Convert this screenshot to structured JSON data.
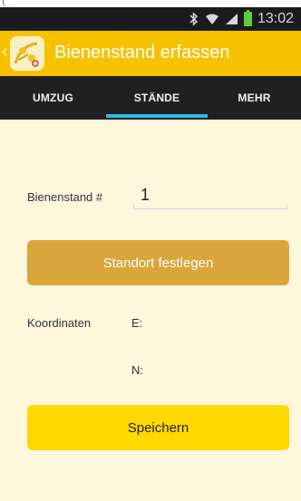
{
  "status_bar": {
    "time": "13:02",
    "icons": [
      "bluetooth-icon",
      "wifi-icon",
      "signal-icon",
      "battery-icon"
    ],
    "battery_color": "#63c93a"
  },
  "frame_glyph": "(",
  "action_bar": {
    "back_glyph": "‹",
    "title": "Bienenstand erfassen",
    "background": "#f6c200"
  },
  "tabs": [
    {
      "label": "UMZUG",
      "active": false
    },
    {
      "label": "STÄNDE",
      "active": true
    },
    {
      "label": "MEHR",
      "active": false
    }
  ],
  "form": {
    "hive_label": "Bienenstand #",
    "hive_value": "1",
    "locate_button": "Standort festlegen",
    "coords_label": "Koordinaten",
    "coord_e_label": "E:",
    "coord_n_label": "N:",
    "save_button": "Speichern"
  },
  "colors": {
    "accent": "#35b6e6",
    "locate_button": "#daa53a",
    "save_button": "#ffd900",
    "content_bg": "#fef7dc"
  }
}
